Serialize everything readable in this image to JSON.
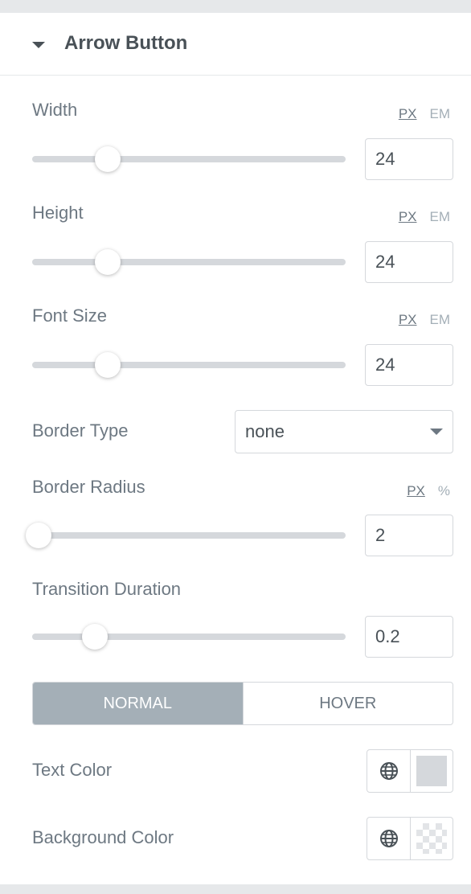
{
  "section": {
    "title": "Arrow Button"
  },
  "width": {
    "label": "Width",
    "units": [
      "PX",
      "EM"
    ],
    "active_unit": "PX",
    "value": "24",
    "slider_fraction": 0.24
  },
  "height": {
    "label": "Height",
    "units": [
      "PX",
      "EM"
    ],
    "active_unit": "PX",
    "value": "24",
    "slider_fraction": 0.24
  },
  "font_size": {
    "label": "Font Size",
    "units": [
      "PX",
      "EM"
    ],
    "active_unit": "PX",
    "value": "24",
    "slider_fraction": 0.24
  },
  "border_type": {
    "label": "Border Type",
    "selected": "none"
  },
  "border_radius": {
    "label": "Border Radius",
    "units": [
      "PX",
      "%"
    ],
    "active_unit": "PX",
    "value": "2",
    "slider_fraction": 0.02
  },
  "transition_duration": {
    "label": "Transition Duration",
    "value": "0.2",
    "slider_fraction": 0.2
  },
  "state_tabs": {
    "normal": "NORMAL",
    "hover": "HOVER",
    "active": "NORMAL"
  },
  "text_color": {
    "label": "Text Color",
    "swatch_color": "#d5d8dc",
    "icon": "globe-icon"
  },
  "background_color": {
    "label": "Background Color",
    "swatch": "transparent",
    "icon": "globe-icon"
  },
  "colors": {
    "accent": "#a4afb7",
    "text": "#495157",
    "label": "#6d7882",
    "border": "#d5d8dc"
  }
}
